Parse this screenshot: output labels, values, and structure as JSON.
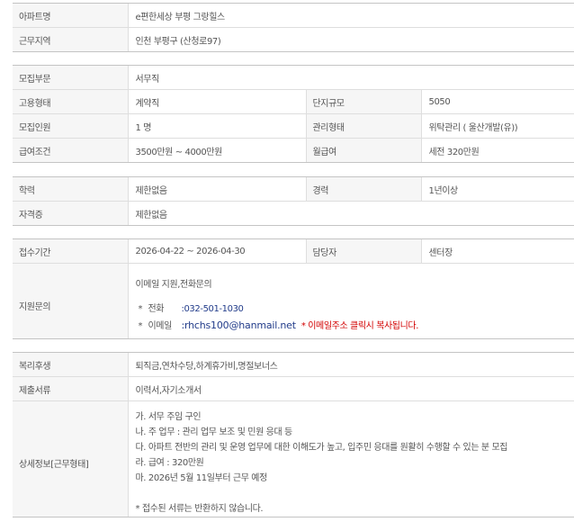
{
  "apartment": {
    "name_label": "아파트명",
    "name_value": "e편한세상 부평 그랑힐스",
    "location_label": "근무지역",
    "location_value": "인천 부평구 (산청로97)"
  },
  "recruit": {
    "dept_label": "모집부문",
    "dept_value": "서무직",
    "employment_label": "고용형태",
    "employment_value": "계약직",
    "complex_size_label": "단지규모",
    "complex_size_value": "5050",
    "headcount_label": "모집인원",
    "headcount_value": "1 명",
    "management_label": "관리형태",
    "management_value": "위탁관리 ( 울산개발(유))",
    "salary_label": "급여조건",
    "salary_value": "3500만원 ~ 4000만원",
    "monthly_label": "월급여",
    "monthly_value": "세전 320만원"
  },
  "qualification": {
    "education_label": "학력",
    "education_value": "제한없음",
    "experience_label": "경력",
    "experience_value": "1년이상",
    "license_label": "자격증",
    "license_value": "제한없음"
  },
  "application": {
    "period_label": "접수기간",
    "period_value": "2026-04-22 ~ 2026-04-30",
    "manager_label": "담당자",
    "manager_value": "센터장",
    "inquiry_label": "지원문의",
    "inquiry_value": "이메일 지원,전화문의",
    "phone_bullet": "*",
    "phone_key": "전화",
    "phone_value": ":032-501-1030",
    "email_bullet": "*",
    "email_key": "이메일",
    "email_value": ":rhchs100@hanmail.net",
    "email_notice": "* 이메일주소 클릭시 복사됩니다."
  },
  "details": {
    "welfare_label": "복리후생",
    "welfare_value": "퇴직금,연차수당,하계휴가비,명절보너스",
    "documents_label": "제출서류",
    "documents_value": "이력서,자기소개서",
    "detail_label": "상세정보[근무형태]",
    "lines": [
      "가. 서무 주임 구인",
      "나. 주 업무 : 관리 업무 보조 및 민원 응대 등",
      "다. 아파트 전반의 관리 및 운영 업무에 대한 이해도가 높고, 입주민 응대를 원활히 수행할 수 있는 분 모집",
      "라. 급여 : 320만원",
      "마. 2026년 5월 11일부터 근무 예정",
      "",
      " * 접수된 서류는 반환하지 않습니다."
    ]
  }
}
